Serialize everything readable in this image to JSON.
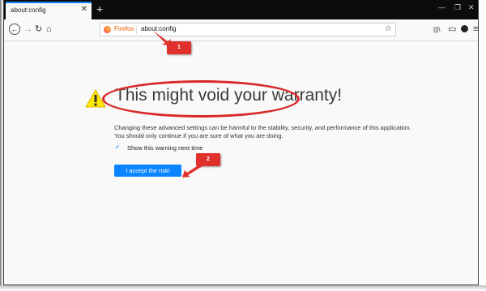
{
  "tab": {
    "title": "about:config",
    "close_icon": "close-icon"
  },
  "titlebar": {
    "new_tab": "+",
    "minimize": "—",
    "restore": "❐",
    "close": "✕"
  },
  "nav": {
    "back": "←",
    "forward": "→",
    "reload": "↻",
    "home": "⌂"
  },
  "urlbar": {
    "identity_label": "Firefox",
    "url": "about:config",
    "star": "☆"
  },
  "toolbar": {
    "library": "|||\\",
    "sidebar": "▭",
    "menu": "≡"
  },
  "warning": {
    "title": "This might void your warranty!",
    "description": "Changing these advanced settings can be harmful to the stability, security, and performance of this application. You should only continue if you are sure of what you are doing.",
    "checkbox_label": "Show this warning next time",
    "checkbox_checked": true,
    "checkmark": "✓",
    "accept_button": "I accept the risk!"
  },
  "annotations": [
    {
      "label": "1"
    },
    {
      "label": "2"
    }
  ],
  "colors": {
    "accent": "#0a84ff",
    "annotation": "#e0302b",
    "titlebar": "#0c0c0d",
    "warning_icon": "#ffe900"
  }
}
